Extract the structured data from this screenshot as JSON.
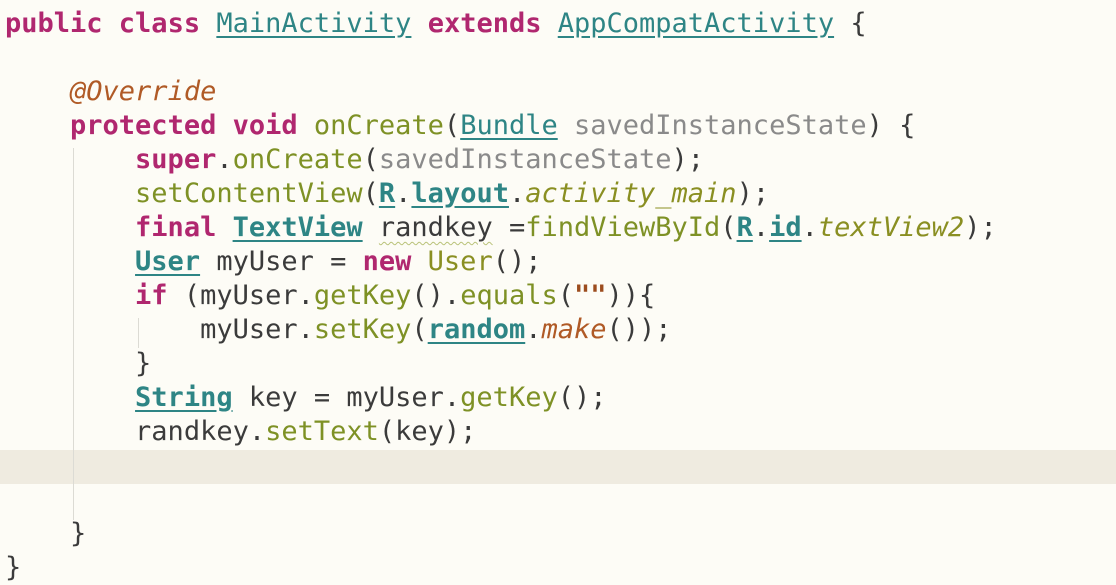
{
  "editor": {
    "language": "Java",
    "highlighted_line": 13,
    "colors": {
      "background": "#fdfcf6",
      "current_line": "#efebe0",
      "keyword": "#b0276f",
      "type_link": "#2e8585",
      "method": "#7e9125",
      "annotation": "#b05a26",
      "parameter": "#8a8a8a",
      "text": "#3b3b3b"
    },
    "lines": [
      {
        "tokens": [
          {
            "t": "public ",
            "c": "kw"
          },
          {
            "t": "class ",
            "c": "kw"
          },
          {
            "t": "MainActivity",
            "c": "typ"
          },
          {
            "t": " ",
            "c": "plain"
          },
          {
            "t": "extends ",
            "c": "kw"
          },
          {
            "t": "AppCompatActivity",
            "c": "typ"
          },
          {
            "t": " {",
            "c": "plain"
          }
        ]
      },
      {
        "tokens": []
      },
      {
        "tokens": [
          {
            "t": "    ",
            "c": "plain"
          },
          {
            "t": "@Override",
            "c": "ann"
          }
        ]
      },
      {
        "tokens": [
          {
            "t": "    ",
            "c": "plain"
          },
          {
            "t": "protected ",
            "c": "kw"
          },
          {
            "t": "void ",
            "c": "kw"
          },
          {
            "t": "onCreate",
            "c": "fn"
          },
          {
            "t": "(",
            "c": "plain"
          },
          {
            "t": "Bundle",
            "c": "typ"
          },
          {
            "t": " ",
            "c": "plain"
          },
          {
            "t": "savedInstanceState",
            "c": "param"
          },
          {
            "t": ") {",
            "c": "plain"
          }
        ]
      },
      {
        "tokens": [
          {
            "t": "        ",
            "c": "plain"
          },
          {
            "t": "super",
            "c": "kw"
          },
          {
            "t": ".",
            "c": "plain"
          },
          {
            "t": "onCreate",
            "c": "fn"
          },
          {
            "t": "(",
            "c": "plain"
          },
          {
            "t": "savedInstanceState",
            "c": "param"
          },
          {
            "t": ");",
            "c": "plain"
          }
        ]
      },
      {
        "tokens": [
          {
            "t": "        ",
            "c": "plain"
          },
          {
            "t": "setContentView",
            "c": "fn"
          },
          {
            "t": "(",
            "c": "plain"
          },
          {
            "t": "R",
            "c": "typ-b"
          },
          {
            "t": ".",
            "c": "plain"
          },
          {
            "t": "layout",
            "c": "typ-b"
          },
          {
            "t": ".",
            "c": "plain"
          },
          {
            "t": "activity_main",
            "c": "fld"
          },
          {
            "t": ");",
            "c": "plain"
          }
        ]
      },
      {
        "tokens": [
          {
            "t": "        ",
            "c": "plain"
          },
          {
            "t": "final ",
            "c": "kw"
          },
          {
            "t": "TextView",
            "c": "typ-b"
          },
          {
            "t": " ",
            "c": "plain"
          },
          {
            "t": "randkey",
            "c": "squiggle"
          },
          {
            "t": " =",
            "c": "plain"
          },
          {
            "t": "findViewById",
            "c": "fn"
          },
          {
            "t": "(",
            "c": "plain"
          },
          {
            "t": "R",
            "c": "typ-b"
          },
          {
            "t": ".",
            "c": "plain"
          },
          {
            "t": "id",
            "c": "typ-b"
          },
          {
            "t": ".",
            "c": "plain"
          },
          {
            "t": "textView2",
            "c": "fld"
          },
          {
            "t": ");",
            "c": "plain"
          }
        ]
      },
      {
        "tokens": [
          {
            "t": "        ",
            "c": "plain"
          },
          {
            "t": "User",
            "c": "typ-b"
          },
          {
            "t": " myUser = ",
            "c": "plain"
          },
          {
            "t": "new ",
            "c": "kw"
          },
          {
            "t": "User",
            "c": "cls"
          },
          {
            "t": "();",
            "c": "plain"
          }
        ]
      },
      {
        "tokens": [
          {
            "t": "        ",
            "c": "plain"
          },
          {
            "t": "if ",
            "c": "kw"
          },
          {
            "t": "(myUser.",
            "c": "plain"
          },
          {
            "t": "getKey",
            "c": "fn"
          },
          {
            "t": "().",
            "c": "plain"
          },
          {
            "t": "equals",
            "c": "fn"
          },
          {
            "t": "(",
            "c": "plain"
          },
          {
            "t": "\"\"",
            "c": "str"
          },
          {
            "t": ")){",
            "c": "plain"
          }
        ]
      },
      {
        "tokens": [
          {
            "t": "            ",
            "c": "plain"
          },
          {
            "t": "myUser.",
            "c": "plain"
          },
          {
            "t": "setKey",
            "c": "fn"
          },
          {
            "t": "(",
            "c": "plain"
          },
          {
            "t": "random",
            "c": "typ-b"
          },
          {
            "t": ".",
            "c": "plain"
          },
          {
            "t": "make",
            "c": "smeth"
          },
          {
            "t": "());",
            "c": "plain"
          }
        ]
      },
      {
        "tokens": [
          {
            "t": "        ",
            "c": "plain"
          },
          {
            "t": "}",
            "c": "plain"
          }
        ]
      },
      {
        "tokens": [
          {
            "t": "        ",
            "c": "plain"
          },
          {
            "t": "String",
            "c": "typ-b"
          },
          {
            "t": " key = myUser.",
            "c": "plain"
          },
          {
            "t": "getKey",
            "c": "fn"
          },
          {
            "t": "();",
            "c": "plain"
          }
        ]
      },
      {
        "tokens": [
          {
            "t": "        ",
            "c": "plain"
          },
          {
            "t": "randkey.",
            "c": "plain"
          },
          {
            "t": "setText",
            "c": "fn"
          },
          {
            "t": "(key);",
            "c": "plain"
          }
        ]
      },
      {
        "tokens": []
      },
      {
        "tokens": []
      },
      {
        "tokens": [
          {
            "t": "    ",
            "c": "plain"
          },
          {
            "t": "}",
            "c": "plain"
          }
        ]
      },
      {
        "tokens": [
          {
            "t": "}",
            "c": "plain"
          }
        ]
      }
    ]
  }
}
